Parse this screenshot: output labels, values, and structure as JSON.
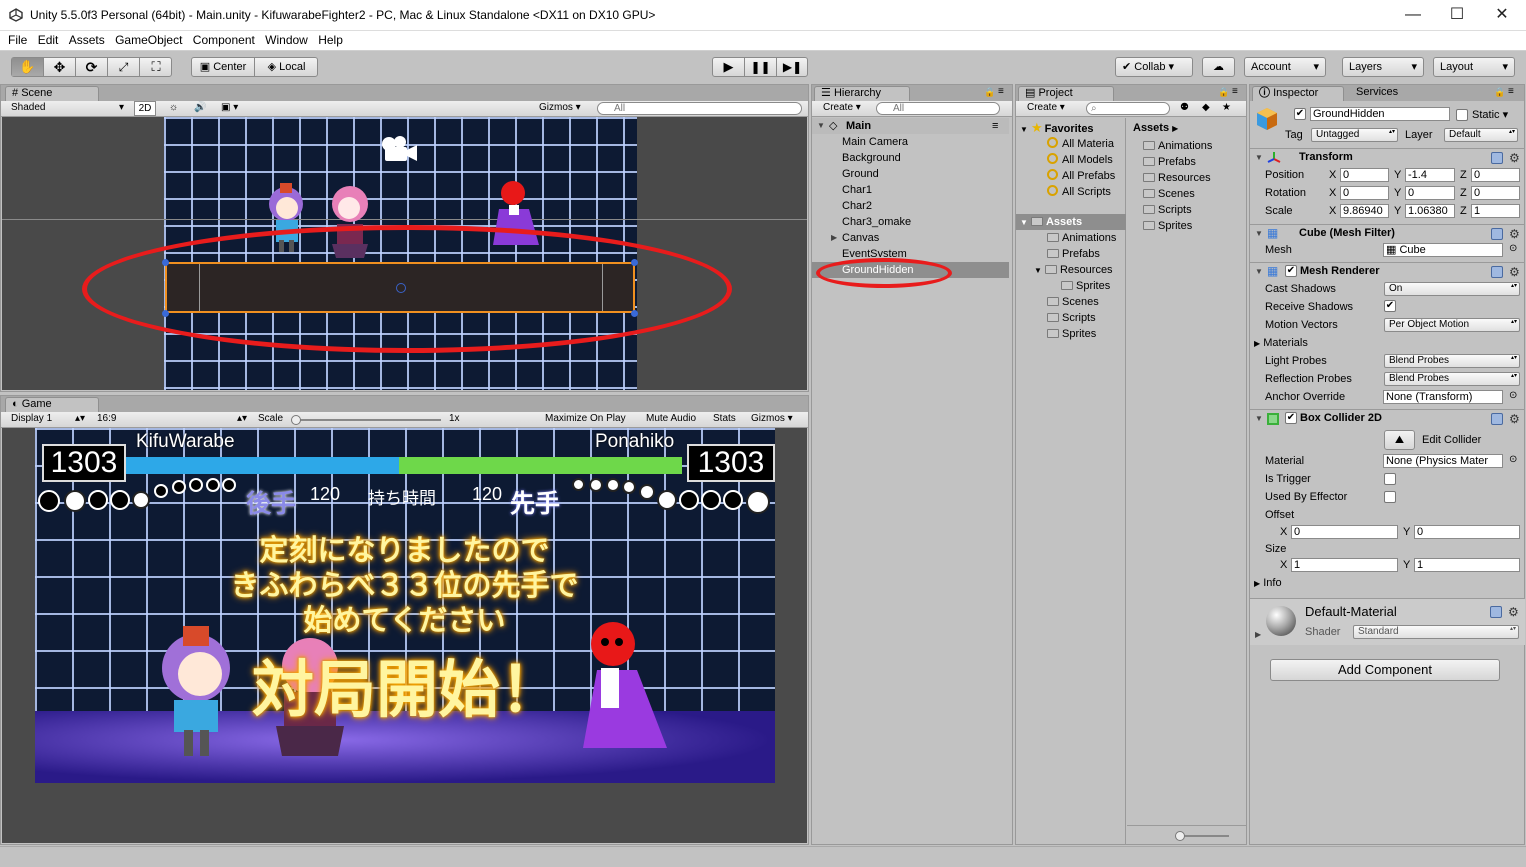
{
  "window": {
    "title": "Unity 5.5.0f3 Personal (64bit) - Main.unity - KifuwarabeFighter2 - PC, Mac & Linux Standalone <DX11 on DX10 GPU>",
    "minimize": "—",
    "maximize": "☐",
    "close": "✕"
  },
  "menu": [
    "File",
    "Edit",
    "Assets",
    "GameObject",
    "Component",
    "Window",
    "Help"
  ],
  "toolbar": {
    "pivot": "Center",
    "space": "Local",
    "collab": "Collab",
    "account": "Account",
    "layers": "Layers",
    "layout": "Layout"
  },
  "scene": {
    "tab": "Scene",
    "shading": "Shaded",
    "mode2d": "2D",
    "gizmos": "Gizmos",
    "search_placeholder": "All"
  },
  "game": {
    "tab": "Game",
    "display": "Display 1",
    "aspect": "16:9",
    "scale_label": "Scale",
    "scale_value": "1x",
    "maximize": "Maximize On Play",
    "mute": "Mute Audio",
    "stats": "Stats",
    "gizmos": "Gizmos",
    "player1_name": "KifuWarabe",
    "player2_name": "Ponahiko",
    "score_left": "1303",
    "score_right": "1303",
    "gote": "後手",
    "time_left": "120",
    "mochi": "持ち時間",
    "time_right": "120",
    "sente": "先手",
    "message": [
      "定刻になりましたので",
      "きふわらべ３３位の先手で",
      "始めてください"
    ],
    "start": "対局開始！",
    "colors": {
      "bar_left": "#2da8e8",
      "bar_right": "#6ed84a"
    }
  },
  "hierarchy": {
    "tab": "Hierarchy",
    "create": "Create",
    "search_placeholder": "All",
    "scene_name": "Main",
    "items": [
      "Main Camera",
      "Background",
      "Ground",
      "Char1",
      "Char2",
      "Char3_omake",
      "Canvas",
      "EventSystem",
      "GroundHidden"
    ]
  },
  "project": {
    "tab": "Project",
    "create": "Create",
    "favorites": "Favorites",
    "fav_items": [
      "All Materia",
      "All Models",
      "All Prefabs",
      "All Scripts"
    ],
    "assets": "Assets",
    "tree": [
      "Animations",
      "Prefabs",
      "Resources",
      "Sprites",
      "Scenes",
      "Scripts",
      "Sprites"
    ],
    "breadcrumb": "Assets",
    "content": [
      "Animations",
      "Prefabs",
      "Resources",
      "Scenes",
      "Scripts",
      "Sprites"
    ]
  },
  "inspector": {
    "tab": "Inspector",
    "services": "Services",
    "object_name": "GroundHidden",
    "static": "Static",
    "tag_label": "Tag",
    "tag_value": "Untagged",
    "layer_label": "Layer",
    "layer_value": "Default",
    "transform": {
      "title": "Transform",
      "position": {
        "label": "Position",
        "x": "0",
        "y": "-1.4",
        "z": "0"
      },
      "rotation": {
        "label": "Rotation",
        "x": "0",
        "y": "0",
        "z": "0"
      },
      "scale": {
        "label": "Scale",
        "x": "9.86940",
        "y": "1.06380",
        "z": "1"
      }
    },
    "mesh_filter": {
      "title": "Cube (Mesh Filter)",
      "mesh_label": "Mesh",
      "mesh_value": "Cube"
    },
    "mesh_renderer": {
      "title": "Mesh Renderer",
      "cast_shadows": "Cast Shadows",
      "cast_shadows_value": "On",
      "receive_shadows": "Receive Shadows",
      "motion_vectors": "Motion Vectors",
      "motion_vectors_value": "Per Object Motion",
      "materials": "Materials",
      "light_probes": "Light Probes",
      "light_probes_value": "Blend Probes",
      "reflection_probes": "Reflection Probes",
      "reflection_probes_value": "Blend Probes",
      "anchor_override": "Anchor Override",
      "anchor_override_value": "None (Transform)"
    },
    "box_collider": {
      "title": "Box Collider 2D",
      "edit_collider": "Edit Collider",
      "material": "Material",
      "material_value": "None (Physics Mater",
      "is_trigger": "Is Trigger",
      "used_by_effector": "Used By Effector",
      "offset": "Offset",
      "offset_x": "0",
      "offset_y": "0",
      "size": "Size",
      "size_x": "1",
      "size_y": "1",
      "info": "Info"
    },
    "material": {
      "name": "Default-Material",
      "shader_label": "Shader",
      "shader_value": "Standard"
    },
    "add_component": "Add Component"
  }
}
